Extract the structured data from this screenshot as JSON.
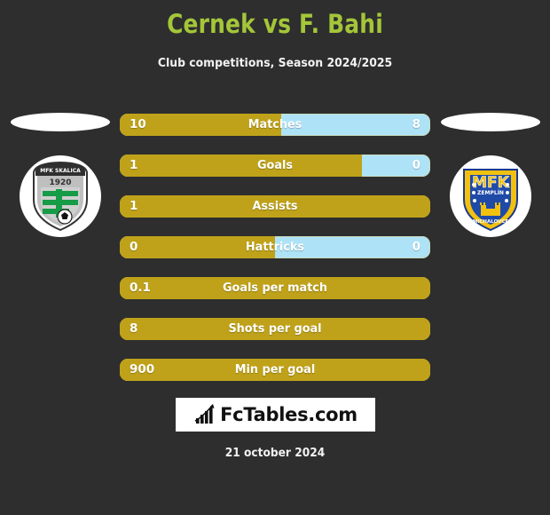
{
  "header": {
    "title": "Cernek vs F. Bahi",
    "subtitle": "Club competitions, Season 2024/2025",
    "title_color": "#a4c639"
  },
  "teams": {
    "home": {
      "crest_name": "mfk-skalica-crest",
      "crest_top_text": "MFK SKALICA",
      "crest_year": "1920"
    },
    "away": {
      "crest_name": "mfk-zemplin-michalovce-crest",
      "crest_top_text": "MFK",
      "crest_mid_text": "ZEMPLÍN",
      "crest_bottom_text": "MICHALOVCE"
    }
  },
  "colors": {
    "background": "#2e2e2e",
    "home_bar": "#bfa21a",
    "away_bar": "#aee3f7",
    "accent": "#a4c639"
  },
  "chart_data": {
    "type": "bar",
    "title": "Cernek vs F. Bahi",
    "subtitle": "Club competitions, Season 2024/2025",
    "categories": [
      "Matches",
      "Goals",
      "Assists",
      "Hattricks",
      "Goals per match",
      "Shots per goal",
      "Min per goal"
    ],
    "series": [
      {
        "name": "Cernek",
        "values": [
          "10",
          "1",
          "1",
          "0",
          "0.1",
          "8",
          "900"
        ]
      },
      {
        "name": "F. Bahi",
        "values": [
          "8",
          "0",
          "",
          "0",
          "",
          "",
          ""
        ]
      }
    ],
    "legend": "none",
    "grid": false
  },
  "stats": [
    {
      "label": "Matches",
      "left": "10",
      "right": "8",
      "fill_pct": 52,
      "full": false
    },
    {
      "label": "Goals",
      "left": "1",
      "right": "0",
      "fill_pct": 78,
      "full": false
    },
    {
      "label": "Assists",
      "left": "1",
      "right": "",
      "fill_pct": 100,
      "full": true
    },
    {
      "label": "Hattricks",
      "left": "0",
      "right": "0",
      "fill_pct": 50,
      "full": false
    },
    {
      "label": "Goals per match",
      "left": "0.1",
      "right": "",
      "fill_pct": 100,
      "full": true
    },
    {
      "label": "Shots per goal",
      "left": "8",
      "right": "",
      "fill_pct": 100,
      "full": true
    },
    {
      "label": "Min per goal",
      "left": "900",
      "right": "",
      "fill_pct": 100,
      "full": true
    }
  ],
  "footer": {
    "logo_text": "FcTables.com",
    "logo_icon": "bar-chart-arrow-icon",
    "date": "21 october 2024"
  }
}
